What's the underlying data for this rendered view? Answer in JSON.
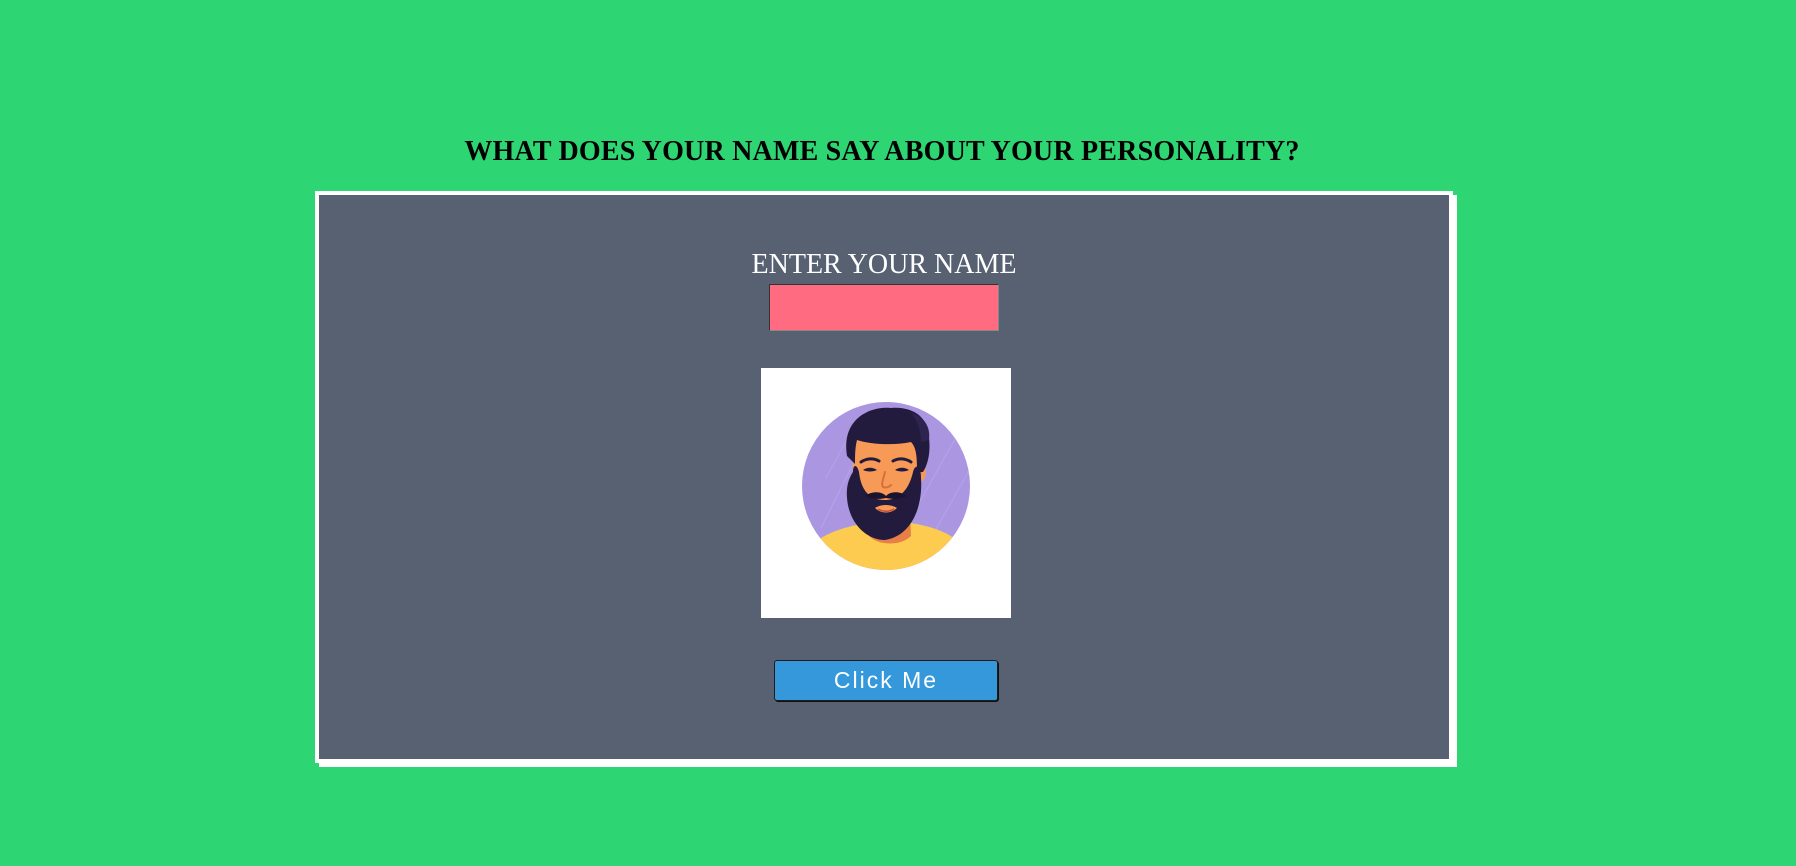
{
  "page": {
    "heading": "WHAT DOES YOUR NAME SAY ABOUT YOUR PERSONALITY?",
    "background_color": "#2ed573"
  },
  "form": {
    "name_label": "ENTER YOUR NAME",
    "name_value": "",
    "input_color": "#ff6b81",
    "card_color": "#576172"
  },
  "avatar": {
    "icon": "bearded-man-avatar-icon"
  },
  "button": {
    "label": "Click Me",
    "color": "#3498db"
  }
}
